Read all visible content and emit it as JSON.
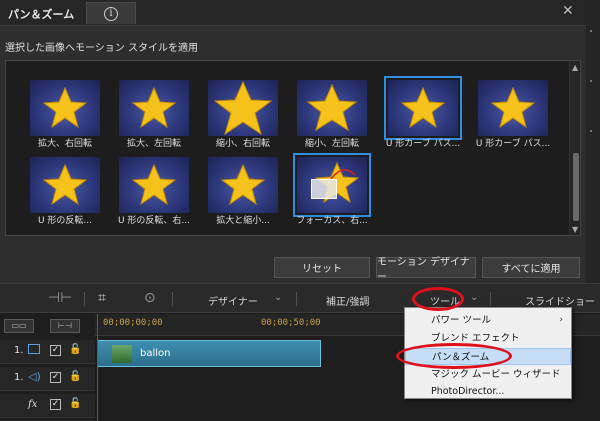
{
  "panel": {
    "title": "パン＆ズーム",
    "info_icon": "i",
    "close_icon": "✕",
    "subtitle": "選択した画像へモーション スタイルを適用"
  },
  "styles": [
    {
      "label": "拡大、右回転",
      "selected": false
    },
    {
      "label": "拡大、左回転",
      "selected": false
    },
    {
      "label": "縮小、右回転",
      "selected": false
    },
    {
      "label": "縮小、左回転",
      "selected": false
    },
    {
      "label": "U 形カーブ パス...",
      "selected": true
    },
    {
      "label": "U 形カーブ パス...",
      "selected": false
    },
    {
      "label": "U 形の反転...",
      "selected": false
    },
    {
      "label": "U 形の反転、右...",
      "selected": false
    },
    {
      "label": "拡大と縮小...",
      "selected": false
    },
    {
      "label": "フォーカス、右...",
      "selected": true
    }
  ],
  "buttons": {
    "reset": "リセット",
    "motion_designer": "モーション デザイナー",
    "apply_all": "すべてに適用"
  },
  "toolbar": {
    "designer": "デザイナー",
    "correction": "補正/強調",
    "tools": "ツール",
    "slideshow": "スライドショー"
  },
  "timeline": {
    "timecode_start": "00;00;00;00",
    "timecode_mid": "00;00;50;00",
    "tracks": [
      {
        "number": "1.",
        "icon": "video-track-icon"
      },
      {
        "number": "1.",
        "icon": "audio-track-icon"
      },
      {
        "number": "fx",
        "icon": "fx-track-icon"
      }
    ],
    "clip_label": "ballon"
  },
  "menu": {
    "items": [
      {
        "label": "パワー ツール",
        "has_submenu": true
      },
      {
        "label": "ブレンド エフェクト",
        "has_submenu": false
      },
      {
        "label": "パン＆ズーム",
        "has_submenu": false,
        "highlighted": true
      },
      {
        "label": "マジック ムービー ウィザード",
        "has_submenu": false
      },
      {
        "label": "PhotoDirector...",
        "has_submenu": false
      }
    ]
  },
  "colors": {
    "selection_blue": "#2f8de4",
    "annotation_red": "#e0101a",
    "clip_teal": "#3f8fb0"
  }
}
